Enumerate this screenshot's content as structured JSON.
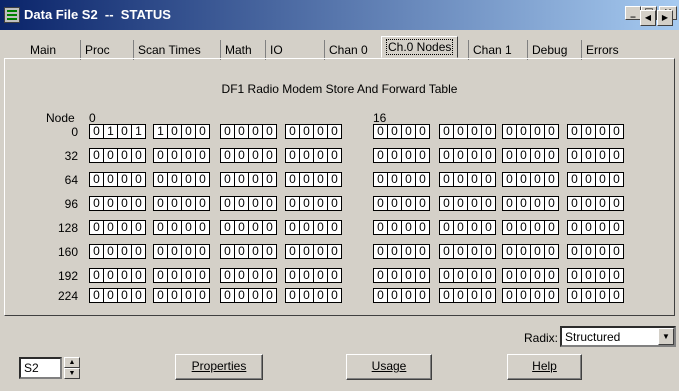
{
  "window": {
    "title": "Data File S2  --  STATUS",
    "minimize_glyph": "_",
    "maximize_glyph": "□",
    "close_glyph": "×"
  },
  "tabs": [
    {
      "label": "Main"
    },
    {
      "label": "Proc"
    },
    {
      "label": "Scan Times"
    },
    {
      "label": "Math"
    },
    {
      "label": "IO"
    },
    {
      "label": "Chan 0"
    },
    {
      "label": "Ch.0 Nodes"
    },
    {
      "label": "Chan 1"
    },
    {
      "label": "Debug"
    },
    {
      "label": "Errors"
    }
  ],
  "active_tab": "Ch.0 Nodes",
  "tab_scroll": {
    "left": "◀",
    "right": "▶"
  },
  "table": {
    "title": "DF1 Radio Modem Store And Forward Table",
    "node_header": "Node",
    "col_marker_left": "0",
    "col_marker_right": "16",
    "rows": [
      {
        "node": "0",
        "groups": [
          "0101",
          "1000",
          "0000",
          "0000",
          "0000",
          "0000",
          "0000",
          "0000"
        ]
      },
      {
        "node": "32",
        "groups": [
          "0000",
          "0000",
          "0000",
          "0000",
          "0000",
          "0000",
          "0000",
          "0000"
        ]
      },
      {
        "node": "64",
        "groups": [
          "0000",
          "0000",
          "0000",
          "0000",
          "0000",
          "0000",
          "0000",
          "0000"
        ]
      },
      {
        "node": "96",
        "groups": [
          "0000",
          "0000",
          "0000",
          "0000",
          "0000",
          "0000",
          "0000",
          "0000"
        ]
      },
      {
        "node": "128",
        "groups": [
          "0000",
          "0000",
          "0000",
          "0000",
          "0000",
          "0000",
          "0000",
          "0000"
        ]
      },
      {
        "node": "160",
        "groups": [
          "0000",
          "0000",
          "0000",
          "0000",
          "0000",
          "0000",
          "0000",
          "0000"
        ]
      },
      {
        "node": "192",
        "groups": [
          "0000",
          "0000",
          "0000",
          "0000",
          "0000",
          "0000",
          "0000",
          "0000"
        ]
      },
      {
        "node": "224",
        "groups": [
          "0000",
          "0000",
          "0000",
          "0000",
          "0000",
          "0000",
          "0000",
          "0000"
        ]
      }
    ]
  },
  "radix": {
    "label": "Radix:",
    "value": "Structured",
    "arrow": "▼"
  },
  "file_field": {
    "value": "S2",
    "up": "▲",
    "down": "▼"
  },
  "buttons": {
    "properties": "Properties",
    "usage": "Usage",
    "help": "Help"
  },
  "colors": {
    "title_start": "#0a246a",
    "title_end": "#a6caf0",
    "face": "#d4d0c8"
  }
}
